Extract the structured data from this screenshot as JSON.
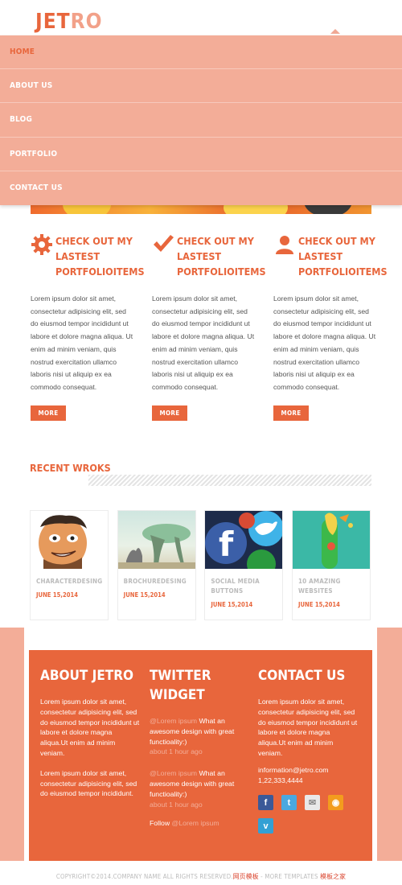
{
  "header": {
    "logo_part1": "JET",
    "logo_part2": "RO"
  },
  "menu": [
    {
      "label": "HOME",
      "active": true
    },
    {
      "label": "ABOUT US",
      "active": false
    },
    {
      "label": "BLOG",
      "active": false
    },
    {
      "label": "PORTFOLIO",
      "active": false
    },
    {
      "label": "CONTACT US",
      "active": false
    }
  ],
  "features": [
    {
      "icon": "gear-icon",
      "title": "CHECK OUT MY LASTEST PORTFOLIOITEMS",
      "text": "Lorem ipsum dolor sit amet, consectetur adipisicing elit, sed do eiusmod tempor incididunt ut labore et dolore magna aliqua. Ut enim ad minim veniam, quis nostrud exercitation ullamco laboris nisi ut aliquip ex ea commodo consequat.",
      "button": "MORE"
    },
    {
      "icon": "checkmark-icon",
      "title": "CHECK OUT MY LASTEST PORTFOLIOITEMS",
      "text": "Lorem ipsum dolor sit amet, consectetur adipisicing elit, sed do eiusmod tempor incididunt ut labore et dolore magna aliqua. Ut enim ad minim veniam, quis nostrud exercitation ullamco laboris nisi ut aliquip ex ea commodo consequat.",
      "button": "MORE"
    },
    {
      "icon": "user-icon",
      "title": "CHECK OUT MY LASTEST PORTFOLIOITEMS",
      "text": "Lorem ipsum dolor sit amet, consectetur adipisicing elit, sed do eiusmod tempor incididunt ut labore et dolore magna aliqua. Ut enim ad minim veniam, quis nostrud exercitation ullamco laboris nisi ut aliquip ex ea commodo consequat.",
      "button": "MORE"
    }
  ],
  "recent": {
    "title": "RECENT WROKS",
    "items": [
      {
        "title": "CHARACTERDESING",
        "date": "JUNE 15,2014"
      },
      {
        "title": "BROCHUREDESING",
        "date": "JUNE 15,2014"
      },
      {
        "title": "SOCIAL MEDIA BUTTONS",
        "date": "JUNE 15,2014"
      },
      {
        "title": "10 AMAZING WEBSITES",
        "date": "JUNE 15,2014"
      }
    ]
  },
  "footer": {
    "about": {
      "title": "ABOUT JETRO",
      "p1": "Lorem ipsum dolor sit amet, consectetur adipisicing elit, sed do eiusmod tempor incididunt ut labore et dolore magna aliqua.Ut enim ad minim veniam.",
      "p2": "Lorem ipsum dolor sit amet, consectetur adipisicing elit, sed do eiusmod tempor incididunt."
    },
    "twitter": {
      "title": "TWITTER WIDGET",
      "tweets": [
        {
          "handle": "@Lorem ipsum",
          "text": " What an awesome design with great functioality:)",
          "time": "about 1 hour ago"
        },
        {
          "handle": "@Lorem ipsum",
          "text": " What an awesome design with great functioality:)",
          "time": "about 1 hour ago"
        }
      ],
      "follow_label": "Follow ",
      "follow_handle": "@Lorem ipsum"
    },
    "contact": {
      "title": "CONTACT US",
      "text": "Lorem ipsum dolor sit amet, consectetur adipisicing elit, sed do eiusmod tempor incididunt ut labore et dolore magna aliqua.Ut enim ad minim veniam.",
      "email": "information@jetro.com",
      "phone": "1,22,333,4444",
      "social": [
        {
          "icon": "facebook-icon",
          "glyph": "f",
          "color": "#3b5998"
        },
        {
          "icon": "twitter-icon",
          "glyph": "t",
          "color": "#4aa8e0"
        },
        {
          "icon": "mail-icon",
          "glyph": "✉",
          "color": "#e9e9e9"
        },
        {
          "icon": "rss-icon",
          "glyph": "◉",
          "color": "#f39c1e"
        },
        {
          "icon": "vimeo-icon",
          "glyph": "v",
          "color": "#33a0d4"
        }
      ]
    }
  },
  "copyright": {
    "text": "COPYRIGHT©2014.COMPANY NAME ALL RIGHTS RESERVED.",
    "link1": "网页模板",
    "sep": " - MORE TEMPLATES ",
    "link2": "模板之家"
  },
  "colors": {
    "accent": "#e8663c",
    "menu_bg": "#f3ad98"
  }
}
